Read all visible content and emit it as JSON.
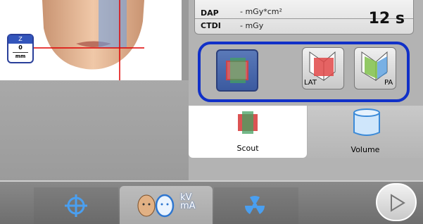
{
  "patient_view": {
    "z_indicator": {
      "axis": "Z",
      "value": "0",
      "unit": "mm"
    },
    "icon": "face-profile-icon"
  },
  "dose": {
    "dap_label": "DAP",
    "dap_value": "- mGy*cm²",
    "ctdi_label": "CTDI",
    "ctdi_value": "- mGy",
    "exposure_time": "12 s"
  },
  "projections": {
    "scout_icon": "scout-projection-icon",
    "lat_label": "LAT",
    "pa_label": "PA",
    "selected": "scout",
    "accent_color": "#1030c8"
  },
  "tabs": {
    "scout_label": "Scout",
    "volume_label": "Volume",
    "selected": "Scout"
  },
  "bottom_bar": {
    "target_icon": "crosshair-target-icon",
    "patient_icon": "patient-heads-icon",
    "kv_label": "kV",
    "ma_label": "mA",
    "radiation_icon": "radiation-icon",
    "next_icon": "play-next-icon"
  }
}
